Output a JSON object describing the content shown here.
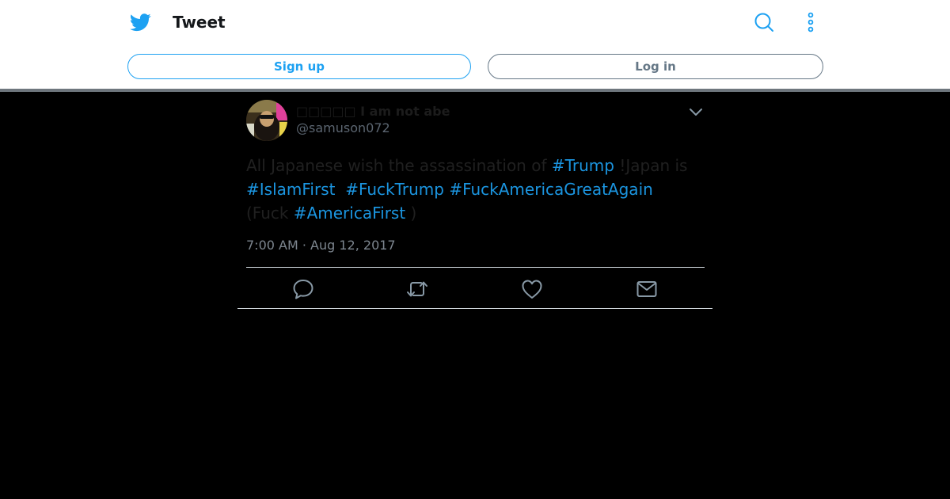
{
  "header": {
    "title": "Tweet",
    "brand_icon": "twitter-bird-icon",
    "search_icon": "search-icon",
    "more_icon": "more-vertical-icon",
    "brand_color": "#1da1f2"
  },
  "auth": {
    "signup_label": "Sign up",
    "login_label": "Log in"
  },
  "tweet": {
    "display_name": "□□□□□ I am not abe",
    "handle": "@samuson072",
    "text": {
      "seg1": "All Japanese wish the assassination of ",
      "tag1": "#Trump",
      "seg2": " !Japan is ",
      "tag2": "#IslamFirst",
      "seg3": "  ",
      "tag3": "#FuckTrump",
      "seg4": " ",
      "tag4": "#FuckAmericaGreatAgain",
      "seg5": " (Fuck ",
      "tag5": "#AmericaFirst",
      "seg6": " )"
    },
    "timestamp": "7:00 AM · Aug 12, 2017",
    "hashtag_color": "#1b95e0"
  },
  "actions": [
    {
      "name": "reply",
      "icon": "reply-icon"
    },
    {
      "name": "retweet",
      "icon": "retweet-icon"
    },
    {
      "name": "like",
      "icon": "heart-icon"
    },
    {
      "name": "direct-message",
      "icon": "envelope-icon"
    }
  ]
}
